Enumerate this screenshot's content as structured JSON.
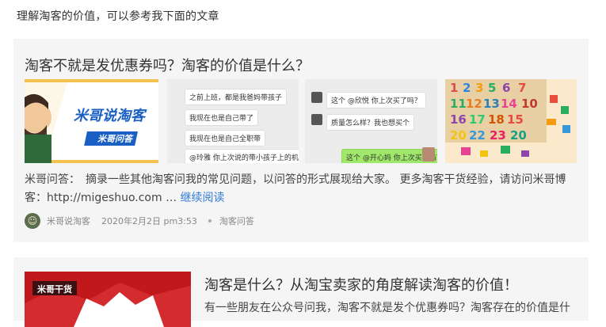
{
  "intro": "理解淘客的价值，可以参考我下面的文章",
  "post1": {
    "title": "淘客不就是发优惠券吗？淘客的价值是什么？",
    "thumb1": {
      "brand": "米哥说淘客",
      "badge": "米哥问答"
    },
    "thumb2": {
      "lines": [
        "之前上班，都是我爸妈带孩子",
        "我现在也是自己带了",
        "我现在也是自己全职带",
        "@玲雅 你上次说的带小孩子上的机器"
      ]
    },
    "thumb3": {
      "lines": [
        "这个 @欣悦 你上次买了吗？",
        "质量怎么样？我也想买个",
        "这个 @开心妈 你上次买了吗？"
      ]
    },
    "excerpt": "米哥问答：　摘录一些其他淘客问我的常见问题，以问答的形式展现给大家。 更多淘客干货经验，请访问米哥博客：http://migeshuo.com … ",
    "more": "继续阅读",
    "author": "米哥说淘客",
    "date": "2020年2月2日 pm3:53",
    "category": "淘客问答"
  },
  "post2": {
    "title": "淘客是什么？从淘宝卖家的角度解读淘客的价值！",
    "thumb_badge": "米哥干货",
    "excerpt": "有一些朋友在公众号问我，淘客不就是发个优惠券吗？淘客存在的价值是什"
  }
}
